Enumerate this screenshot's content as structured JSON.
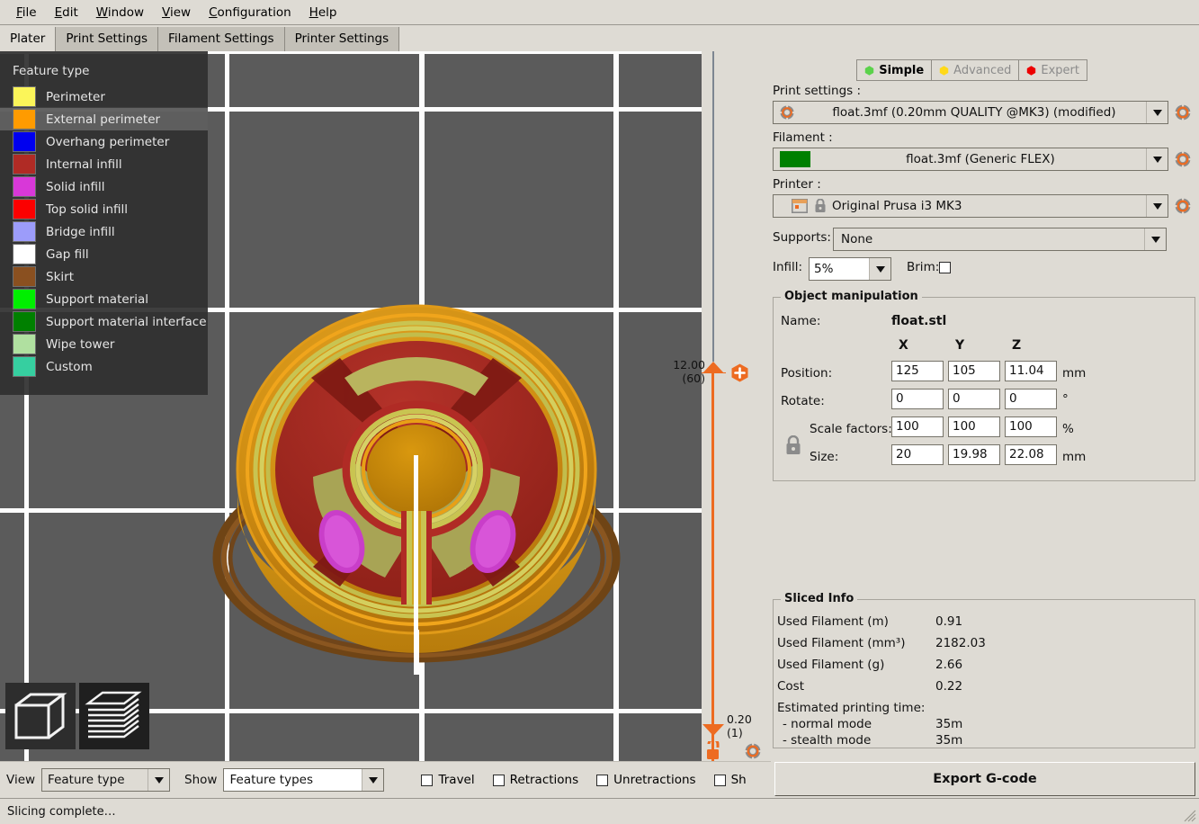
{
  "menubar": {
    "items": [
      {
        "label": "File",
        "mnemonic": "F"
      },
      {
        "label": "Edit",
        "mnemonic": "E"
      },
      {
        "label": "Window",
        "mnemonic": "W"
      },
      {
        "label": "View",
        "mnemonic": "V"
      },
      {
        "label": "Configuration",
        "mnemonic": "C"
      },
      {
        "label": "Help",
        "mnemonic": "H"
      }
    ]
  },
  "tabs": [
    {
      "label": "Plater",
      "active": true
    },
    {
      "label": "Print Settings",
      "active": false
    },
    {
      "label": "Filament Settings",
      "active": false
    },
    {
      "label": "Printer Settings",
      "active": false
    }
  ],
  "legend": {
    "title": "Feature type",
    "items": [
      {
        "label": "Perimeter",
        "color": "#fbf559",
        "highlighted": false
      },
      {
        "label": "External perimeter",
        "color": "#ff9b00",
        "highlighted": true
      },
      {
        "label": "Overhang perimeter",
        "color": "#0000ef",
        "highlighted": false
      },
      {
        "label": "Internal infill",
        "color": "#b02b25",
        "highlighted": false
      },
      {
        "label": "Solid infill",
        "color": "#d838d8",
        "highlighted": false
      },
      {
        "label": "Top solid infill",
        "color": "#fc0000",
        "highlighted": false
      },
      {
        "label": "Bridge infill",
        "color": "#9c9cfa",
        "highlighted": false
      },
      {
        "label": "Gap fill",
        "color": "#ffffff",
        "highlighted": false
      },
      {
        "label": "Skirt",
        "color": "#8a5020",
        "highlighted": false
      },
      {
        "label": "Support material",
        "color": "#00ef00",
        "highlighted": false
      },
      {
        "label": "Support material interface",
        "color": "#008000",
        "highlighted": false
      },
      {
        "label": "Wipe tower",
        "color": "#b0e0a0",
        "highlighted": false
      },
      {
        "label": "Custom",
        "color": "#36cfa0",
        "highlighted": false
      }
    ]
  },
  "viewport": {
    "view_icon_3d": "cube-icon",
    "view_icon_preview": "layers-icon",
    "background_color": "#5b5b5b",
    "grid_color": "#fdfdfd"
  },
  "layer_slider": {
    "top_value": "12.00",
    "top_layer": "(60)",
    "bottom_value": "0.20",
    "bottom_layer": "(1)",
    "accent_color": "#ed6b21",
    "add_button": "add-color-change-icon",
    "lock_button": "unlock-icon",
    "cog_button": "gear-icon"
  },
  "mode_selector": {
    "modes": [
      {
        "label": "Simple",
        "color": "#5bd24b",
        "active": true
      },
      {
        "label": "Advanced",
        "color": "#ffd919",
        "active": false
      },
      {
        "label": "Expert",
        "color": "#ed0000",
        "active": false
      }
    ]
  },
  "presets": {
    "print_settings_label": "Print settings :",
    "print_settings_value": "float.3mf (0.20mm QUALITY @MK3) (modified)",
    "filament_label": "Filament :",
    "filament_value": "float.3mf (Generic FLEX)",
    "filament_color": "#008000",
    "printer_label": "Printer :",
    "printer_value": "Original Prusa i3 MK3",
    "supports_label": "Supports:",
    "supports_value": "None",
    "infill_label": "Infill:",
    "infill_value": "5%",
    "brim_label": "Brim:",
    "brim_checked": false
  },
  "object_manipulation": {
    "title": "Object manipulation",
    "name_label": "Name:",
    "name_value": "float.stl",
    "axes": [
      "X",
      "Y",
      "Z"
    ],
    "rows": [
      {
        "label": "Position:",
        "values": [
          "125",
          "105",
          "11.04"
        ],
        "unit": "mm"
      },
      {
        "label": "Rotate:",
        "values": [
          "0",
          "0",
          "0"
        ],
        "unit": "°"
      },
      {
        "label": "Scale factors:",
        "values": [
          "100",
          "100",
          "100"
        ],
        "unit": "%"
      },
      {
        "label": "Size:",
        "values": [
          "20",
          "19.98",
          "22.08"
        ],
        "unit": "mm"
      }
    ],
    "lock_icon": "locked-uniform-scaling-icon"
  },
  "sliced_info": {
    "title": "Sliced Info",
    "rows": [
      {
        "label": "Used Filament (m)",
        "value": "0.91"
      },
      {
        "label": "Used Filament (mm³)",
        "value": "2182.03"
      },
      {
        "label": "Used Filament (g)",
        "value": "2.66"
      },
      {
        "label": "Cost",
        "value": "0.22"
      }
    ],
    "time_label": "Estimated printing time:",
    "time_rows": [
      {
        "label": "- normal mode",
        "value": "35m"
      },
      {
        "label": "- stealth mode",
        "value": "35m"
      }
    ]
  },
  "export_button_label": "Export G-code",
  "bottom_toolbar": {
    "view_label": "View",
    "view_value": "Feature type",
    "show_label": "Show",
    "show_value": "Feature types",
    "checkboxes": [
      {
        "label": "Travel",
        "checked": false
      },
      {
        "label": "Retractions",
        "checked": false
      },
      {
        "label": "Unretractions",
        "checked": false
      },
      {
        "label": "Sh",
        "checked": false
      }
    ]
  },
  "statusbar": {
    "message": "Slicing complete…"
  }
}
